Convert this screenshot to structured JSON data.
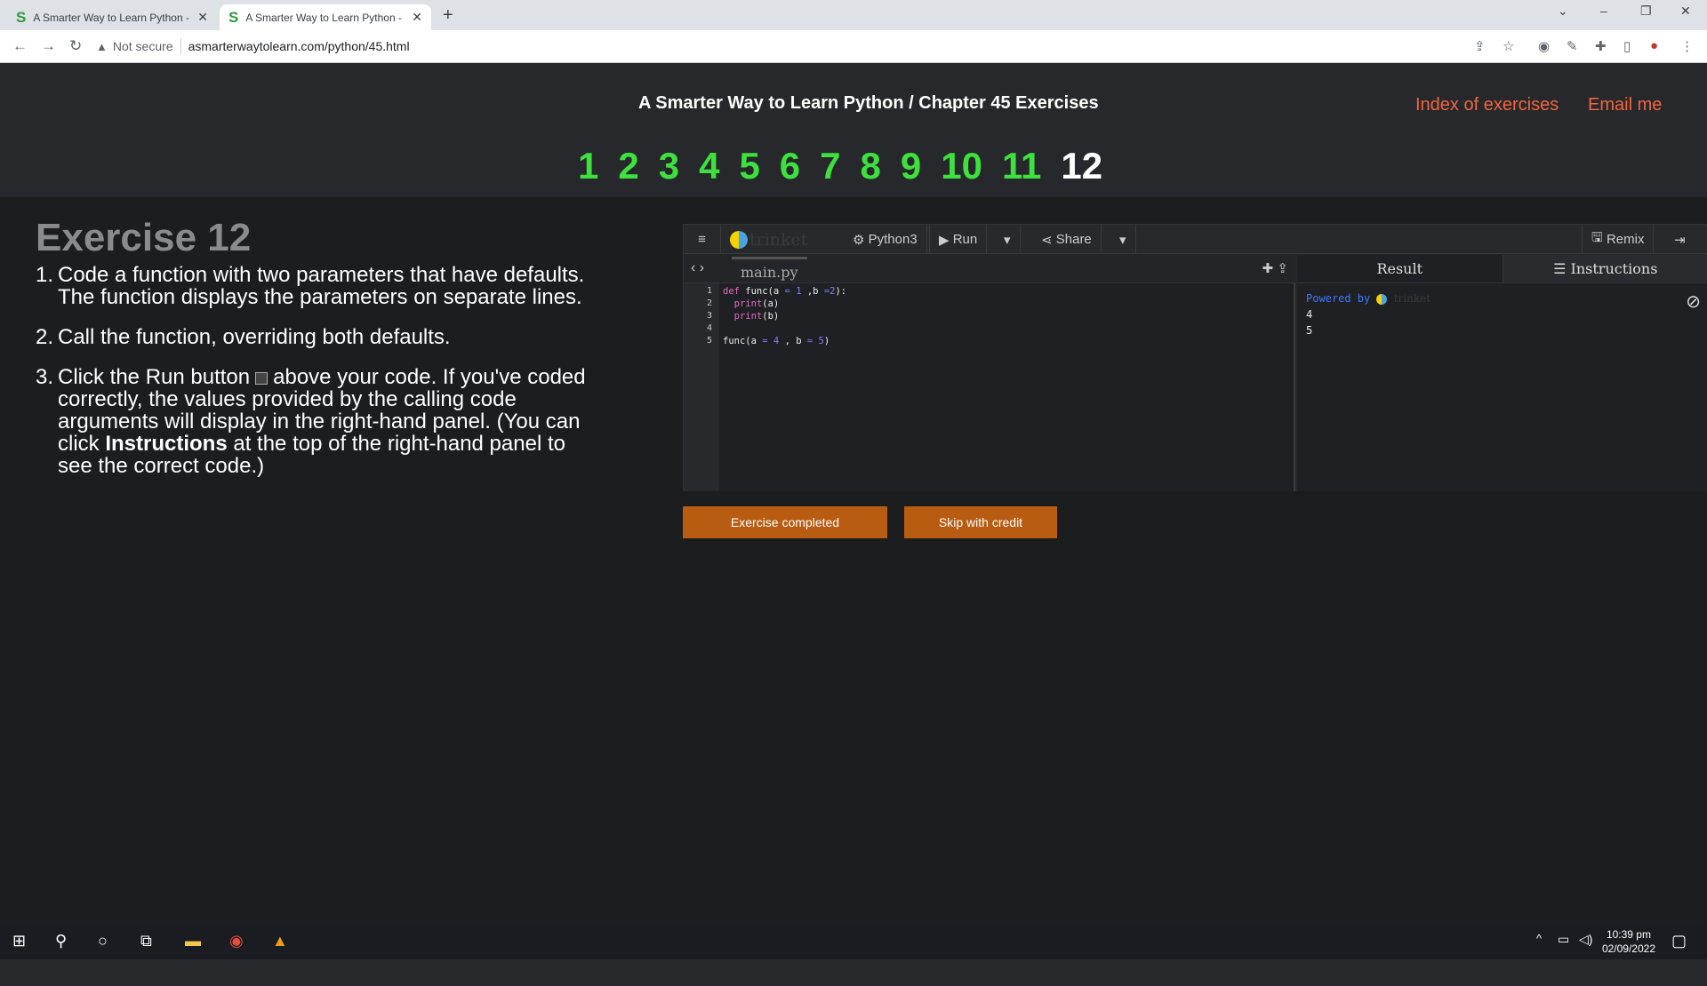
{
  "browser": {
    "tabs": [
      {
        "title": "A Smarter Way to Learn Python -",
        "favicon": "S",
        "active": false
      },
      {
        "title": "A Smarter Way to Learn Python -",
        "favicon": "S",
        "active": true
      }
    ],
    "url_warning": "Not secure",
    "url": "asmarterwaytolearn.com/python/45.html"
  },
  "header": {
    "title": "A Smarter Way to Learn Python / Chapter 45 Exercises",
    "index_link": "Index of exercises",
    "email_link": "Email me",
    "exercise_numbers": [
      "1",
      "2",
      "3",
      "4",
      "5",
      "6",
      "7",
      "8",
      "9",
      "10",
      "11",
      "12"
    ],
    "current": "12"
  },
  "exercise": {
    "title": "Exercise 12",
    "steps": [
      {
        "n": "1.",
        "text": "Code a function with two parameters that have defaults. The function displays the parameters on separate lines."
      },
      {
        "n": "2.",
        "text": "Call the function, overriding both defaults."
      },
      {
        "n": "3.",
        "text_before": "Click the Run button",
        "text_after": "above your code. If you've coded correctly, the values provided by the calling code arguments will display in the right-hand panel. (You can click",
        "bold": "Instructions",
        "text_end": "at the top of the right-hand panel to see the correct code.)"
      }
    ]
  },
  "trinket": {
    "logo_word": "trinket",
    "language": "Python3",
    "run_label": "Run",
    "share_label": "Share",
    "remix_label": "Remix",
    "filename": "main.py",
    "line_numbers": [
      "1",
      "2",
      "3",
      "4",
      "5"
    ],
    "result_tab": "Result",
    "instructions_tab": "Instructions",
    "powered_by": "Powered by",
    "output": [
      "4",
      "5"
    ]
  },
  "buttons": {
    "completed": "Exercise completed",
    "skip": "Skip with credit"
  },
  "taskbar": {
    "time": "10:39 pm",
    "date": "02/09/2022"
  }
}
